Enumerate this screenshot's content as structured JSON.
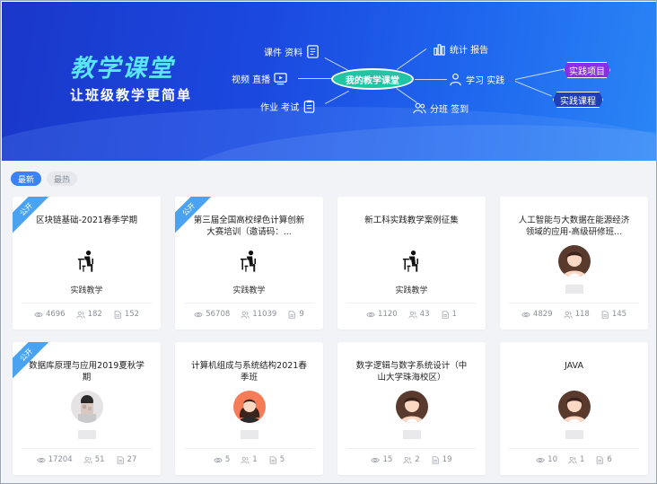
{
  "banner": {
    "title": "教学课堂",
    "subtitle": "让班级教学更简单",
    "center_label": "我的教学课堂",
    "nodes": {
      "courseware": "课件  资料",
      "video": "视频  直播",
      "homework": "作业  考试",
      "stats": "统计  报告",
      "learn": "学习  实践",
      "group": "分班  签到"
    },
    "tag_project": "实践项目",
    "tag_course": "实践课程"
  },
  "tabs": [
    {
      "label": "最新",
      "active": true
    },
    {
      "label": "最热",
      "active": false
    }
  ],
  "ribbon_label": "公开",
  "cards": [
    {
      "title": "区块链基础-2021春季学期",
      "public": true,
      "image": "practice-icon",
      "subtitle": "实践教学",
      "views": "4696",
      "members": "182",
      "docs": "152"
    },
    {
      "title": "第三届全国高校绿色计算创新大赛培训（邀请码：...",
      "public": true,
      "image": "practice-icon",
      "subtitle": "实践教学",
      "views": "56708",
      "members": "11039",
      "docs": "9"
    },
    {
      "title": "新工科实践教学案例征集",
      "public": false,
      "image": "practice-icon",
      "subtitle": "实践教学",
      "views": "1120",
      "members": "43",
      "docs": "1"
    },
    {
      "title": "人工智能与大数据在能源经济领域的应用-高级研修班...",
      "public": false,
      "image": "avatar-icon",
      "subtitle": "",
      "views": "4829",
      "members": "118",
      "docs": "145"
    },
    {
      "title": "数据库原理与应用2019夏秋学期",
      "public": true,
      "image": "avatar-photo",
      "subtitle": "",
      "views": "17204",
      "members": "51",
      "docs": "27"
    },
    {
      "title": "计算机组成与系统结构2021春季班",
      "public": false,
      "image": "avatar-female-icon",
      "subtitle": "",
      "views": "5",
      "members": "1",
      "docs": "5"
    },
    {
      "title": "数字逻辑与数字系统设计（中山大学珠海校区）",
      "public": false,
      "image": "avatar-icon",
      "subtitle": "",
      "views": "15",
      "members": "2",
      "docs": "19"
    },
    {
      "title": "JAVA",
      "public": false,
      "image": "avatar-icon",
      "subtitle": "",
      "views": "10",
      "members": "1",
      "docs": "6"
    }
  ],
  "colors": {
    "accent": "#3b82f6",
    "banner_title": "#59e6f5",
    "ribbon": "#4aa3f0"
  }
}
